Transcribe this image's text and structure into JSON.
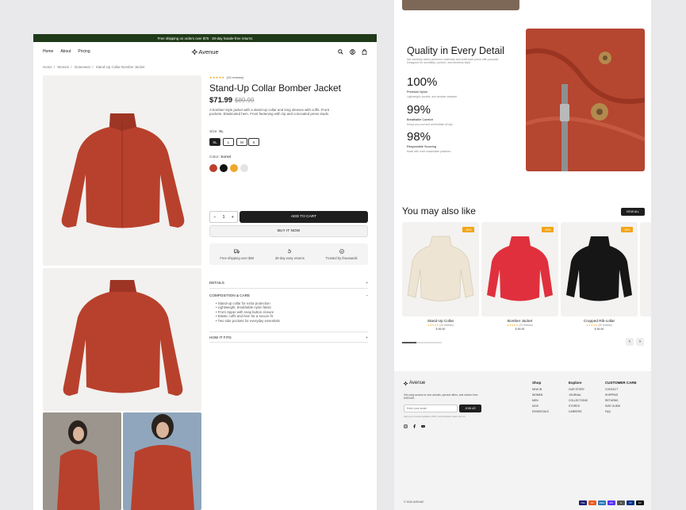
{
  "promo": "Free shipping on orders over $75 · 30-day hassle-free returns",
  "nav": {
    "links": [
      "Home",
      "About",
      "Pricing"
    ],
    "brand": "Avenue"
  },
  "breadcrumb": [
    "Home",
    "Women",
    "Outerwear",
    "Stand-Up Collar Bomber Jacket"
  ],
  "product": {
    "reviews": "(23 reviews)",
    "stars": "★★★★★",
    "title": "Stand-Up Collar Bomber Jacket",
    "price": "$71.99",
    "old_price": "$89.99",
    "description": "A bomber-style jacket with a stand-up collar and long sleeves with cuffs. Front pockets. Elasticated hem. Front fastening with zip and concealed press studs.",
    "size_label": "Size:",
    "size_value": "XL",
    "sizes": [
      "XL",
      "L",
      "M",
      "S"
    ],
    "color_label": "Color:",
    "color_value": "Sorrel",
    "swatches": [
      "#b8412d",
      "#111111",
      "#f0a62a",
      "#e3e3e3"
    ],
    "qty": "1",
    "qty_minus": "−",
    "qty_plus": "+",
    "add_to_cart": "ADD TO CART",
    "buy_now": "BUY IT NOW",
    "perks": [
      "Free shipping over $50",
      "30-day easy returns",
      "Trusted by thousands"
    ],
    "accordion": [
      "DETAILS",
      "COMPOSITION & CARE",
      "HOW IT FITS"
    ],
    "acc_open": "−",
    "acc_closed": "+",
    "bullets": [
      "Stand-up collar for extra protection",
      "Lightweight, breathable nylon fabric",
      "Front zipper with snap button closure",
      "Elastic cuffs and hem for a secure fit",
      "Two side pockets for everyday essentials"
    ]
  },
  "quality": {
    "title": "Quality in Every Detail",
    "subtitle": "We carefully select premium materials and craft each piece with purpose. Designed for durability, comfort, and timeless style.",
    "stats": [
      {
        "value": "100%",
        "label": "Premium Nylon",
        "sub": "Lightweight, durable, and weather-resistant"
      },
      {
        "value": "99%",
        "label": "Breathable Comfort",
        "sub": "Keeps you cool and comfortable all day"
      },
      {
        "value": "98%",
        "label": "Responsible Sourcing",
        "sub": "Made with more sustainable practices"
      }
    ]
  },
  "also_like": {
    "title": "You may also like",
    "view_all": "VIEW ALL",
    "products": [
      {
        "name": "Stand-Up Collar",
        "reviews": "(23 reviews)",
        "price": "$ 59.90",
        "badge": "-20%",
        "color": "#ede4d3"
      },
      {
        "name": "Bomber Jacket",
        "reviews": "(23 reviews)",
        "price": "$ 59.90",
        "badge": "-20%",
        "color": "#e0303d"
      },
      {
        "name": "Cropped Rib-collar",
        "reviews": "(23 reviews)",
        "price": "$ 59.90",
        "badge": "-20%",
        "color": "#161616"
      }
    ],
    "prev": "‹",
    "next": "›"
  },
  "footer": {
    "brand": "Avenue",
    "tagline": "Get early access to new arrivals, special offers, and stories from AVENUE.",
    "email_placeholder": "Enter your email",
    "join": "JOIN US",
    "note": "Sign up to receive updates, offers, and exclusive news from us.",
    "cols": [
      {
        "title": "Shop",
        "items": [
          "NEW IN",
          "WOMEN",
          "MEN",
          "KIDS",
          "ESSENTIALS"
        ]
      },
      {
        "title": "Explore",
        "items": [
          "OUR STORY",
          "JOURNAL",
          "COLLECTIONS",
          "STORES",
          "CAREERS"
        ]
      },
      {
        "title": "CUSTOMER CARE",
        "items": [
          "CONTACT",
          "SHIPPING",
          "RETURNS",
          "SIZE GUIDE",
          "FAQ"
        ]
      }
    ],
    "copyright": "© 2026 AVENUE",
    "payments": [
      "VISA",
      "MC",
      "AMEX",
      "PAY",
      "G",
      "PP",
      "PAY"
    ]
  }
}
